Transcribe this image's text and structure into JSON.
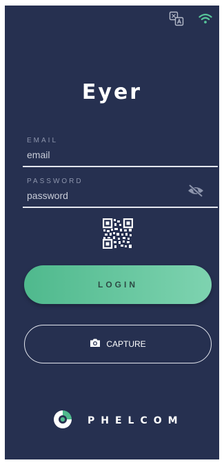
{
  "app": {
    "title": "Eyer"
  },
  "status_bar": {
    "icons": [
      "translate-icon",
      "wifi-icon"
    ]
  },
  "form": {
    "email": {
      "label": "EMAIL",
      "placeholder": "email",
      "value": ""
    },
    "password": {
      "label": "PASSWORD",
      "placeholder": "password",
      "value": "",
      "visibility_icon": "eye-off-icon"
    },
    "qr_icon": "qr-code-icon"
  },
  "actions": {
    "login_label": "LOGIN",
    "capture_label": "CAPTURE",
    "capture_icon": "camera-icon"
  },
  "brand": {
    "name": "PHELCOM",
    "logo_icon": "phelcom-logo-icon"
  },
  "colors": {
    "background": "#263050",
    "accent_start": "#4fb98d",
    "accent_end": "#7ed3b0",
    "text": "#ffffff"
  }
}
